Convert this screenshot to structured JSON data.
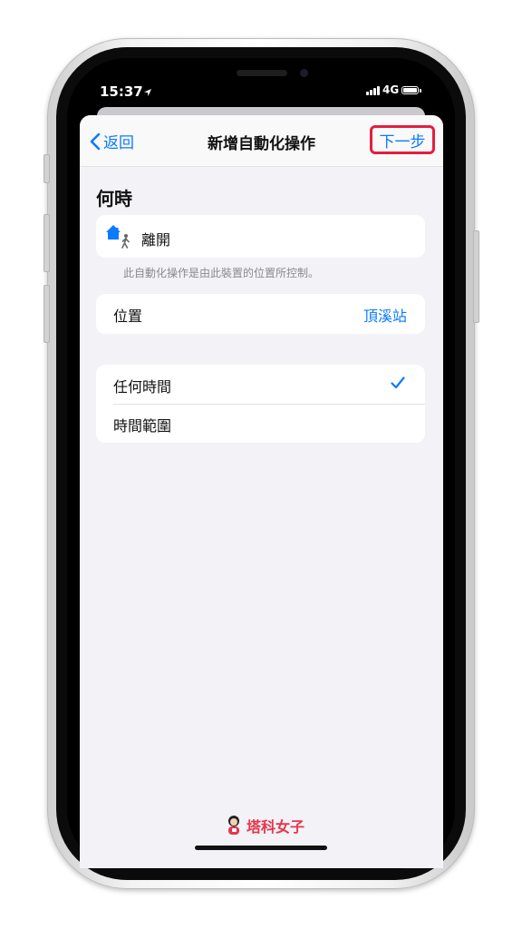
{
  "status_bar": {
    "time": "15:37",
    "network": "4G"
  },
  "nav": {
    "back_label": "返回",
    "title": "新增自動化操作",
    "next_label": "下一步"
  },
  "when": {
    "section_title": "何時",
    "trigger_label": "離開",
    "footnote": "此自動化操作是由此裝置的位置所控制。",
    "location_label": "位置",
    "location_value": "頂溪站"
  },
  "time_options": [
    {
      "label": "任何時間",
      "selected": true
    },
    {
      "label": "時間範圍",
      "selected": false
    }
  ],
  "watermark": {
    "text": "塔科女子"
  },
  "colors": {
    "accent": "#0a7aff",
    "highlight": "#e41e3f",
    "background": "#f2f2f7"
  }
}
